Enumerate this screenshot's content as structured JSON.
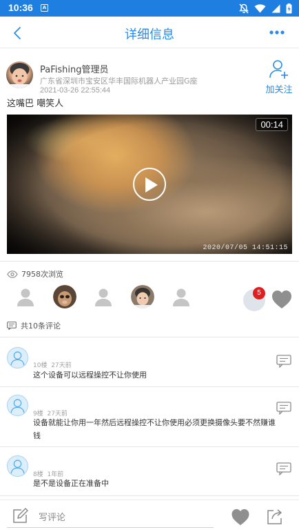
{
  "status_bar": {
    "time": "10:36",
    "app_icon_glyph": "A",
    "icons": [
      "notifications-off-icon",
      "wifi-icon",
      "signal-icon",
      "battery-icon"
    ]
  },
  "nav": {
    "title": "详细信息",
    "back_icon": "chevron-left-icon",
    "more_icon": "more-dots-icon"
  },
  "post": {
    "author_name": "PaFishing管理员",
    "location": "广东省深圳市宝安区华丰国际机器人产业园G座",
    "time": "2021-03-26 22:55:44",
    "follow_label": "加关注",
    "text": "这嘴巴 嘲笑人",
    "video": {
      "duration": "00:14",
      "timestamp": "2020/07/05 14:51:15"
    }
  },
  "stats": {
    "views": "7958次浏览",
    "likes_count": "5",
    "comments_label": "共10条评论"
  },
  "comments": [
    {
      "floor": "10楼",
      "time": "27天前",
      "text": "这个设备可以远程操控不让你使用"
    },
    {
      "floor": "9楼",
      "time": "27天前",
      "text": "设备就能让你用一年然后远程操控不让你使用必须更换摄像头要不然赚谁钱"
    },
    {
      "floor": "8楼",
      "time": "1年前",
      "text": "是不是设备正在准备中"
    }
  ],
  "bottom_bar": {
    "write_placeholder": "写评论"
  },
  "colors": {
    "status_bar": "#1f7fe0",
    "accent": "#2a8be6",
    "badge_red": "#e02020",
    "icon_gray": "#9a9a9a"
  }
}
